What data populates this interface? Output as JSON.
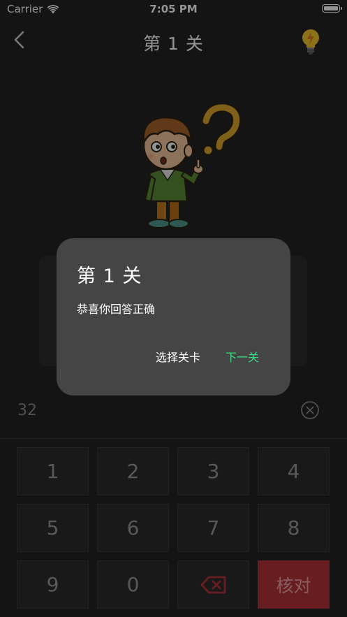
{
  "status_bar": {
    "carrier": "Carrier",
    "time": "7:05 PM"
  },
  "nav": {
    "title": "第 1 关",
    "back_icon": "chevron-left-icon",
    "hint_icon": "lightbulb-icon"
  },
  "input": {
    "value": "32",
    "clear_icon": "clear-circle-icon"
  },
  "keypad": {
    "keys": [
      "1",
      "2",
      "3",
      "4",
      "5",
      "6",
      "7",
      "8",
      "9",
      "0"
    ],
    "backspace_icon": "backspace-icon",
    "check_label": "核对",
    "check_color": "#b3333a"
  },
  "dialog": {
    "title": "第 1 关",
    "message": "恭喜你回答正确",
    "select_level_label": "选择关卡",
    "next_level_label": "下一关",
    "next_color": "#3ddc84"
  }
}
